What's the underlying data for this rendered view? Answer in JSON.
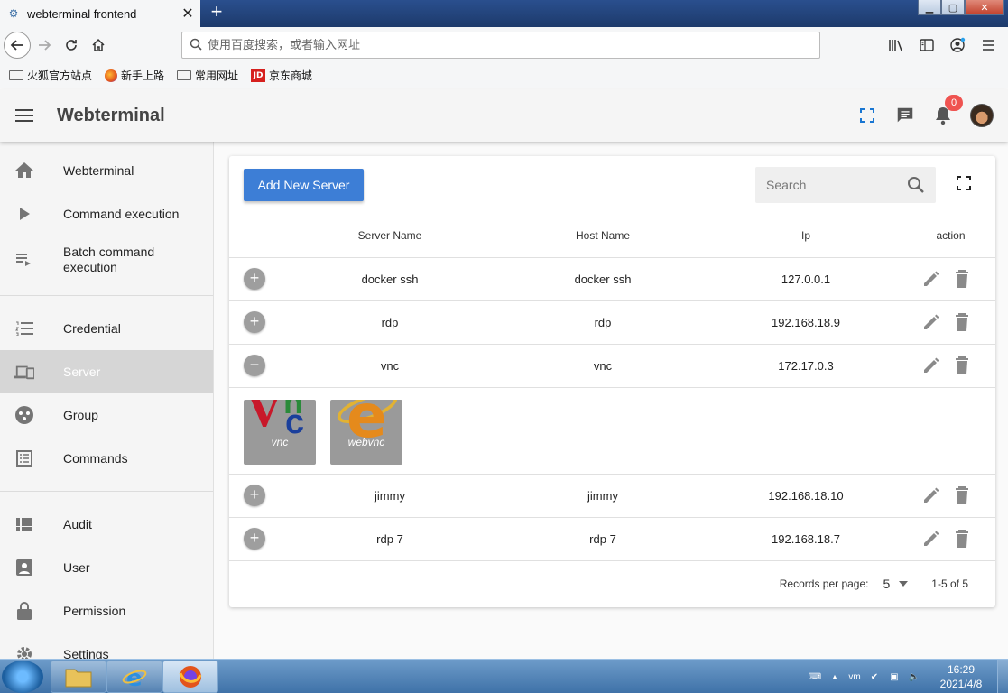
{
  "browser": {
    "tab_title": "webterminal frontend",
    "new_tab": "+",
    "url_placeholder": "使用百度搜索，或者输入网址",
    "bookmarks": [
      "火狐官方站点",
      "新手上路",
      "常用网址",
      "京东商城"
    ],
    "jd_logo": "JD"
  },
  "app": {
    "title": "Webterminal",
    "notification_count": "0"
  },
  "sidebar": {
    "items": [
      {
        "label": "Webterminal",
        "icon": "home-icon"
      },
      {
        "label": "Command execution",
        "icon": "play-icon"
      },
      {
        "label": "Batch command execution",
        "icon": "playlist-play-icon"
      },
      {
        "label": "Credential",
        "icon": "format-list-numbered-icon"
      },
      {
        "label": "Server",
        "icon": "devices-icon"
      },
      {
        "label": "Group",
        "icon": "group-icon"
      },
      {
        "label": "Commands",
        "icon": "list-box-icon"
      },
      {
        "label": "Audit",
        "icon": "view-list-icon"
      },
      {
        "label": "User",
        "icon": "account-box-icon"
      },
      {
        "label": "Permission",
        "icon": "lock-icon"
      },
      {
        "label": "Settings",
        "icon": "gear-icon"
      }
    ],
    "active": "Server"
  },
  "toolbar": {
    "add_label": "Add New Server",
    "search_placeholder": "Search"
  },
  "table": {
    "headers": [
      "Server Name",
      "Host Name",
      "Ip",
      "action"
    ],
    "rows": [
      {
        "name": "docker ssh",
        "host": "docker ssh",
        "ip": "127.0.0.1",
        "expanded": false
      },
      {
        "name": "rdp",
        "host": "rdp",
        "ip": "192.168.18.9",
        "expanded": false
      },
      {
        "name": "vnc",
        "host": "vnc",
        "ip": "172.17.0.3",
        "expanded": true
      },
      {
        "name": "jimmy",
        "host": "jimmy",
        "ip": "192.168.18.10",
        "expanded": false
      },
      {
        "name": "rdp 7",
        "host": "rdp 7",
        "ip": "192.168.18.7",
        "expanded": false
      }
    ],
    "expanded_tiles": [
      "vnc",
      "webvnc"
    ]
  },
  "pagination": {
    "label": "Records per page:",
    "per_page": "5",
    "range": "1-5 of 5"
  },
  "taskbar": {
    "time": "16:29",
    "date": "2021/4/8"
  }
}
